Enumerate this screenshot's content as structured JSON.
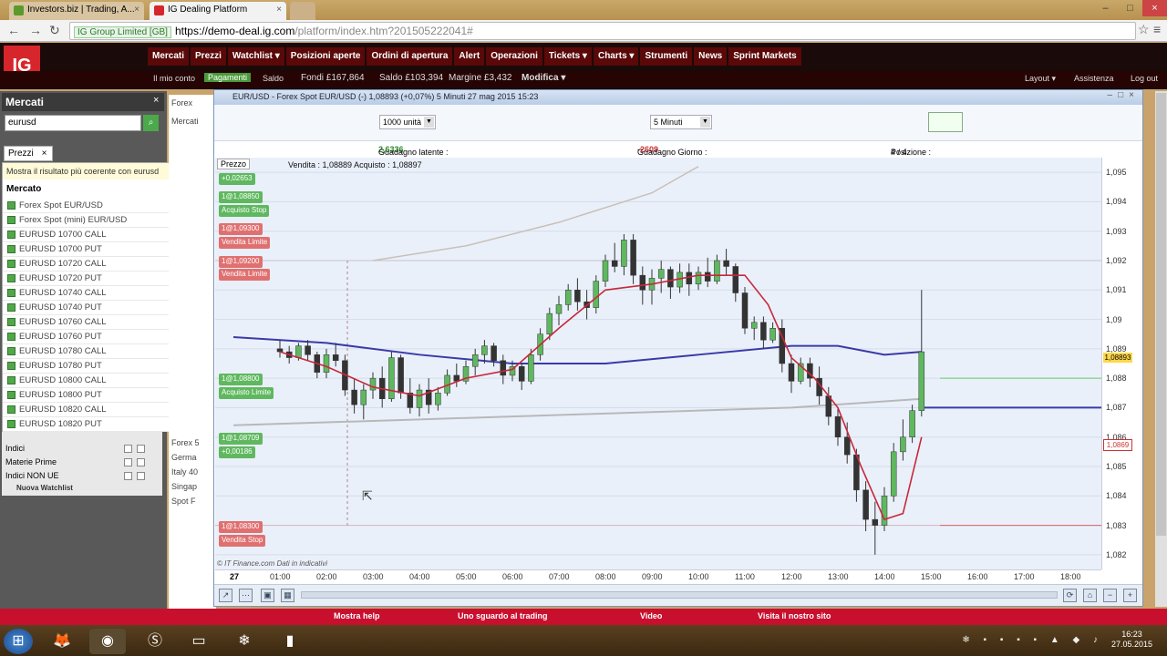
{
  "browser": {
    "tabs": [
      {
        "title": "Investors.biz | Trading, A...",
        "color": "#5a9a2a"
      },
      {
        "title": "IG Dealing Platform",
        "color": "#d6262b"
      }
    ],
    "url_secure": "IG Group Limited [GB]",
    "url_host": "https://demo-deal.ig.com",
    "url_path": "/platform/index.htm?201505222041#"
  },
  "app": {
    "logo": "IG",
    "menu": [
      "Mercati",
      "Prezzi",
      "Watchlist ▾",
      "Posizioni aperte",
      "Ordini di apertura",
      "Alert",
      "Operazioni",
      "Tickets ▾",
      "Charts ▾",
      "Strumenti",
      "News",
      "Sprint Markets"
    ],
    "account": {
      "my_account": "Il mio conto",
      "payments": "Pagamenti",
      "balance_label": "Saldo",
      "funds": "Fondi £167,864",
      "saldo": "Saldo £103,394",
      "margin": "Margine £3,432",
      "modifica": "Modifica ▾",
      "layout": "Layout ▾",
      "assistenza": "Assistenza",
      "logout": "Log out"
    }
  },
  "left": {
    "header": "Mercati",
    "search_value": "eurusd",
    "prezzi_tab": "Prezzi",
    "hint": "Mostra il risultato più coerente con eurusd",
    "mercato_header": "Mercato",
    "results": [
      "Forex Spot EUR/USD",
      "Forex Spot (mini) EUR/USD",
      "EURUSD 10700 CALL",
      "EURUSD 10700 PUT",
      "EURUSD 10720 CALL",
      "EURUSD 10720 PUT",
      "EURUSD 10740 CALL",
      "EURUSD 10740 PUT",
      "EURUSD 10760 CALL",
      "EURUSD 10760 PUT",
      "EURUSD 10780 CALL",
      "EURUSD 10780 PUT",
      "EURUSD 10800 CALL",
      "EURUSD 10800 PUT",
      "EURUSD 10820 CALL",
      "EURUSD 10820 PUT"
    ],
    "lower": [
      "Indici",
      "Materie Prime",
      "Indici NON UE"
    ],
    "new_watchlist": "Nuova Watchlist",
    "bg_items": [
      "Forex",
      "Mercati",
      "Forex 5",
      "Germa",
      "Italy 40",
      "Singap",
      "Spot F"
    ]
  },
  "chart": {
    "window_title": "EUR/USD - Forex Spot EUR/USD (-)   1,08893 (+0,07%)   5 Minuti 27 mag 2015 15:23",
    "size_select": "1000 unità",
    "interval_select": "5 Minuti",
    "unrealized_label": "Guadagno latente : ",
    "unrealized_value": "2,6336",
    "day_gain_label": "Guadagno Giorno : ",
    "day_gain_value": "-2609",
    "position_label": "Posizione : ",
    "position_value": "4 / 4",
    "prezzo_label": "Prezzo",
    "bid_ask": "Vendita : 1,08889 Acquisto : 1,08897",
    "source": "© IT Finance.com  Dati in indicativi",
    "day": "27",
    "orders": [
      {
        "top": 190,
        "text": "+0,02653",
        "type": "green"
      },
      {
        "top": 210,
        "text": "1@1,08850",
        "type": "green"
      },
      {
        "top": 225,
        "text": "Acquisto Stop",
        "type": "green"
      },
      {
        "top": 245,
        "text": "1@1,09300",
        "type": "red"
      },
      {
        "top": 260,
        "text": "Vendita Limite",
        "type": "red"
      },
      {
        "top": 281,
        "text": "1@1,09200",
        "type": "red"
      },
      {
        "top": 295,
        "text": "Vendita Limite",
        "type": "red"
      },
      {
        "top": 410,
        "text": "1@1,08800",
        "type": "green"
      },
      {
        "top": 425,
        "text": "Acquisto Limite",
        "type": "green"
      },
      {
        "top": 475,
        "text": "1@1,08709",
        "type": "green"
      },
      {
        "top": 490,
        "text": "+0,00186",
        "type": "green"
      },
      {
        "top": 572,
        "text": "1@1,08300",
        "type": "red"
      },
      {
        "top": 587,
        "text": "Vendita Stop",
        "type": "red"
      }
    ],
    "y_ticks": [
      "1,095",
      "1,094",
      "1,093",
      "1,092",
      "1,091",
      "1,09",
      "1,089",
      "1,088",
      "1,087",
      "1,086",
      "1,085",
      "1,084",
      "1,083",
      "1,082"
    ],
    "y_tick_values": [
      1.095,
      1.094,
      1.093,
      1.092,
      1.091,
      1.09,
      1.089,
      1.088,
      1.087,
      1.086,
      1.085,
      1.084,
      1.083,
      1.082
    ],
    "x_ticks": [
      "01:00",
      "02:00",
      "03:00",
      "04:00",
      "05:00",
      "06:00",
      "07:00",
      "08:00",
      "09:00",
      "10:00",
      "11:00",
      "12:00",
      "13:00",
      "14:00",
      "15:00",
      "16:00",
      "17:00",
      "18:00"
    ],
    "price_tag": "1,08893",
    "price_tag2": "1,0869",
    "ylim": [
      1.0815,
      1.0955
    ],
    "candles": [
      [
        0.0,
        1.089,
        1.0893,
        1.0887,
        1.0889
      ],
      [
        0.2,
        1.0889,
        1.0891,
        1.0885,
        1.0887
      ],
      [
        0.4,
        1.0887,
        1.0892,
        1.0886,
        1.0891
      ],
      [
        0.6,
        1.0891,
        1.0893,
        1.0886,
        1.0888
      ],
      [
        0.8,
        1.0888,
        1.0889,
        1.088,
        1.0882
      ],
      [
        1.0,
        1.0882,
        1.089,
        1.088,
        1.0888
      ],
      [
        1.2,
        1.0888,
        1.0892,
        1.0884,
        1.0886
      ],
      [
        1.4,
        1.0886,
        1.0888,
        1.0874,
        1.0876
      ],
      [
        1.6,
        1.0876,
        1.088,
        1.0868,
        1.0871
      ],
      [
        1.8,
        1.0871,
        1.0878,
        1.0866,
        1.0876
      ],
      [
        2.0,
        1.0876,
        1.0882,
        1.0873,
        1.088
      ],
      [
        2.2,
        1.088,
        1.0884,
        1.087,
        1.0873
      ],
      [
        2.4,
        1.0873,
        1.0889,
        1.0872,
        1.0887
      ],
      [
        2.6,
        1.0887,
        1.0888,
        1.0873,
        1.0875
      ],
      [
        2.8,
        1.0875,
        1.088,
        1.0868,
        1.087
      ],
      [
        3.0,
        1.087,
        1.0878,
        1.0867,
        1.0876
      ],
      [
        3.2,
        1.0876,
        1.088,
        1.0868,
        1.0871
      ],
      [
        3.4,
        1.0871,
        1.0877,
        1.0869,
        1.0875
      ],
      [
        3.6,
        1.0875,
        1.0883,
        1.0874,
        1.0881
      ],
      [
        3.8,
        1.0881,
        1.0885,
        1.0877,
        1.0879
      ],
      [
        4.0,
        1.0879,
        1.0886,
        1.0878,
        1.0884
      ],
      [
        4.2,
        1.0884,
        1.089,
        1.0881,
        1.0888
      ],
      [
        4.4,
        1.0888,
        1.0893,
        1.0885,
        1.0891
      ],
      [
        4.6,
        1.0891,
        1.0892,
        1.0884,
        1.0886
      ],
      [
        4.8,
        1.0886,
        1.0888,
        1.0878,
        1.0881
      ],
      [
        5.0,
        1.0881,
        1.0886,
        1.0879,
        1.0884
      ],
      [
        5.2,
        1.0884,
        1.0885,
        1.0876,
        1.0879
      ],
      [
        5.4,
        1.0879,
        1.089,
        1.0878,
        1.0888
      ],
      [
        5.6,
        1.0888,
        1.0897,
        1.0886,
        1.0895
      ],
      [
        5.8,
        1.0895,
        1.0904,
        1.0893,
        1.0902
      ],
      [
        6.0,
        1.0902,
        1.0908,
        1.0898,
        1.0905
      ],
      [
        6.2,
        1.0905,
        1.0912,
        1.0903,
        1.091
      ],
      [
        6.4,
        1.091,
        1.0914,
        1.0903,
        1.0906
      ],
      [
        6.6,
        1.0906,
        1.091,
        1.09,
        1.0904
      ],
      [
        6.8,
        1.0904,
        1.0915,
        1.0902,
        1.0913
      ],
      [
        7.0,
        1.0913,
        1.0922,
        1.0911,
        1.092
      ],
      [
        7.2,
        1.092,
        1.0926,
        1.0916,
        1.0918
      ],
      [
        7.4,
        1.0918,
        1.0929,
        1.0915,
        1.0927
      ],
      [
        7.6,
        1.0927,
        1.0929,
        1.0912,
        1.0915
      ],
      [
        7.8,
        1.0915,
        1.0918,
        1.0905,
        1.091
      ],
      [
        8.0,
        1.091,
        1.0917,
        1.0905,
        1.0914
      ],
      [
        8.2,
        1.0914,
        1.092,
        1.0909,
        1.0917
      ],
      [
        8.4,
        1.0917,
        1.0918,
        1.0907,
        1.0911
      ],
      [
        8.6,
        1.0911,
        1.0919,
        1.0909,
        1.0916
      ],
      [
        8.8,
        1.0916,
        1.0919,
        1.0908,
        1.0912
      ],
      [
        9.0,
        1.0912,
        1.0918,
        1.091,
        1.0916
      ],
      [
        9.2,
        1.0916,
        1.0921,
        1.0911,
        1.0913
      ],
      [
        9.4,
        1.0913,
        1.0922,
        1.0912,
        1.092
      ],
      [
        9.6,
        1.092,
        1.0924,
        1.0915,
        1.0918
      ],
      [
        9.8,
        1.0918,
        1.0919,
        1.0906,
        1.0909
      ],
      [
        10.0,
        1.0909,
        1.0911,
        1.0895,
        1.0897
      ],
      [
        10.2,
        1.0897,
        1.0901,
        1.0893,
        1.0899
      ],
      [
        10.4,
        1.0899,
        1.0901,
        1.089,
        1.0893
      ],
      [
        10.6,
        1.0893,
        1.0899,
        1.0892,
        1.0897
      ],
      [
        10.8,
        1.0897,
        1.09,
        1.0882,
        1.0885
      ],
      [
        11.0,
        1.0885,
        1.0888,
        1.0875,
        1.0879
      ],
      [
        11.2,
        1.0879,
        1.0887,
        1.0878,
        1.0885
      ],
      [
        11.4,
        1.0885,
        1.0887,
        1.0877,
        1.088
      ],
      [
        11.6,
        1.088,
        1.0884,
        1.0871,
        1.0874
      ],
      [
        11.8,
        1.0874,
        1.0877,
        1.0864,
        1.0867
      ],
      [
        12.0,
        1.0867,
        1.087,
        1.0857,
        1.086
      ],
      [
        12.2,
        1.086,
        1.0865,
        1.0851,
        1.0854
      ],
      [
        12.4,
        1.0854,
        1.0856,
        1.0838,
        1.0842
      ],
      [
        12.6,
        1.0842,
        1.0845,
        1.0828,
        1.0832
      ],
      [
        12.8,
        1.0832,
        1.0838,
        1.082,
        1.083
      ],
      [
        13.0,
        1.083,
        1.0843,
        1.0828,
        1.084
      ],
      [
        13.2,
        1.084,
        1.0858,
        1.0838,
        1.0855
      ],
      [
        13.4,
        1.0855,
        1.0866,
        1.0852,
        1.086
      ],
      [
        13.6,
        1.086,
        1.0871,
        1.0858,
        1.0869
      ],
      [
        13.8,
        1.0869,
        1.091,
        1.0867,
        1.0889
      ]
    ],
    "ma_red": [
      [
        0.0,
        1.0889
      ],
      [
        1.0,
        1.0884
      ],
      [
        2.0,
        1.0877
      ],
      [
        3.0,
        1.0874
      ],
      [
        4.0,
        1.088
      ],
      [
        5.0,
        1.0883
      ],
      [
        6.0,
        1.0897
      ],
      [
        7.0,
        1.091
      ],
      [
        8.0,
        1.0912
      ],
      [
        9.0,
        1.0915
      ],
      [
        10.0,
        1.0915
      ],
      [
        10.5,
        1.0905
      ],
      [
        11.0,
        1.0887
      ],
      [
        11.5,
        1.088
      ],
      [
        12.0,
        1.087
      ],
      [
        12.5,
        1.085
      ],
      [
        13.0,
        1.0832
      ],
      [
        13.4,
        1.0834
      ],
      [
        13.8,
        1.086
      ]
    ],
    "ma_blue": [
      [
        -1.0,
        1.0894
      ],
      [
        1.0,
        1.0892
      ],
      [
        3.0,
        1.0888
      ],
      [
        5.0,
        1.0885
      ],
      [
        7.0,
        1.0885
      ],
      [
        9.0,
        1.0888
      ],
      [
        11.0,
        1.0891
      ],
      [
        12.0,
        1.0891
      ],
      [
        13.0,
        1.0888
      ],
      [
        13.8,
        1.0889
      ]
    ],
    "ma_grey": [
      [
        -1.0,
        1.0864
      ],
      [
        3.0,
        1.0866
      ],
      [
        7.0,
        1.0868
      ],
      [
        11.0,
        1.087
      ],
      [
        13.8,
        1.0873
      ]
    ],
    "ma_arc": [
      [
        2.0,
        1.092
      ],
      [
        4.0,
        1.0925
      ],
      [
        6.0,
        1.0933
      ],
      [
        8.0,
        1.0943
      ],
      [
        9.0,
        1.0952
      ]
    ]
  },
  "footer": [
    "Mostra help",
    "Uno sguardo al trading",
    "Video",
    "Visita il nostro sito"
  ],
  "taskbar": {
    "time": "16:23",
    "date": "27.05.2015"
  },
  "colors": {
    "brand": "#d6262b",
    "accent": "#5fb85f",
    "bear": "#e05a5a"
  }
}
